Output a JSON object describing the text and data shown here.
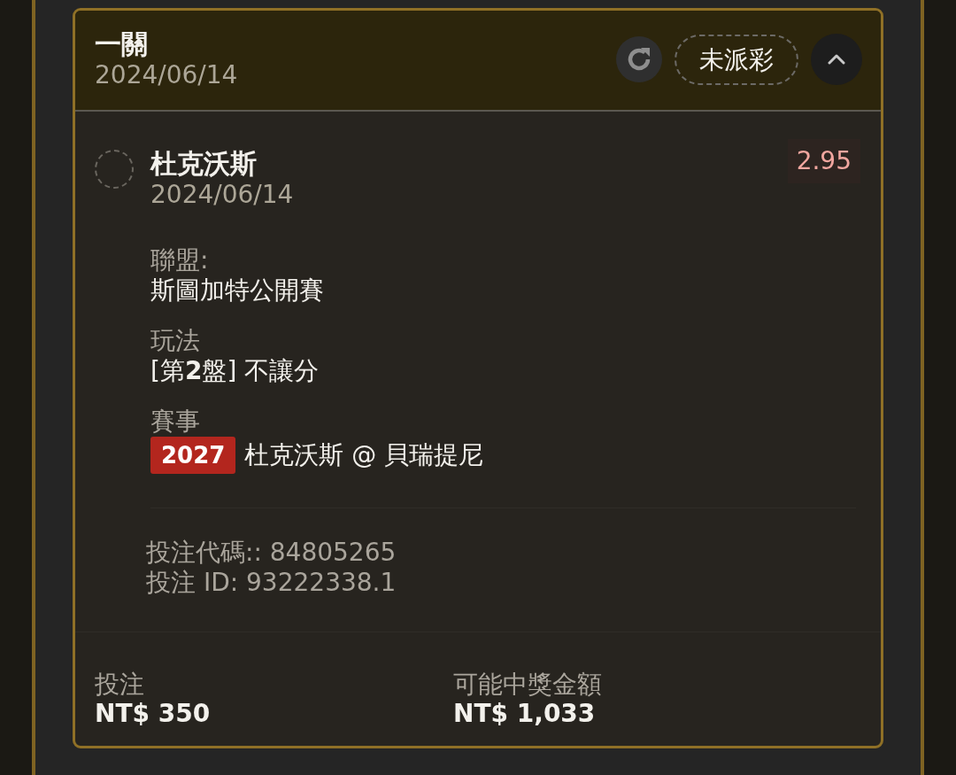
{
  "bet_card": {
    "title": "一關",
    "date": "2024/06/14",
    "status": "未派彩",
    "expanded": true
  },
  "selections": [
    {
      "selected": false,
      "team": "杜克沃斯",
      "date": "2024/06/14",
      "odds": "2.95",
      "fields": [
        {
          "kind": "text",
          "label": "聯盟:",
          "value": "斯圖加特公開賽"
        },
        {
          "kind": "text",
          "label": "玩法",
          "value": "[第**2**盤] 不讓分"
        },
        {
          "kind": "event",
          "label": "賽事",
          "badge": "2027",
          "value": "杜克沃斯 @ 貝瑞提尼"
        }
      ],
      "codes": [
        "投注代碼:: 84805265",
        "投注 ID: 93222338.1"
      ]
    }
  ],
  "footer": [
    {
      "label": "投注",
      "value": "NT$ 350"
    },
    {
      "label": "可能中獎金額",
      "value": "NT$ 1,033"
    }
  ]
}
